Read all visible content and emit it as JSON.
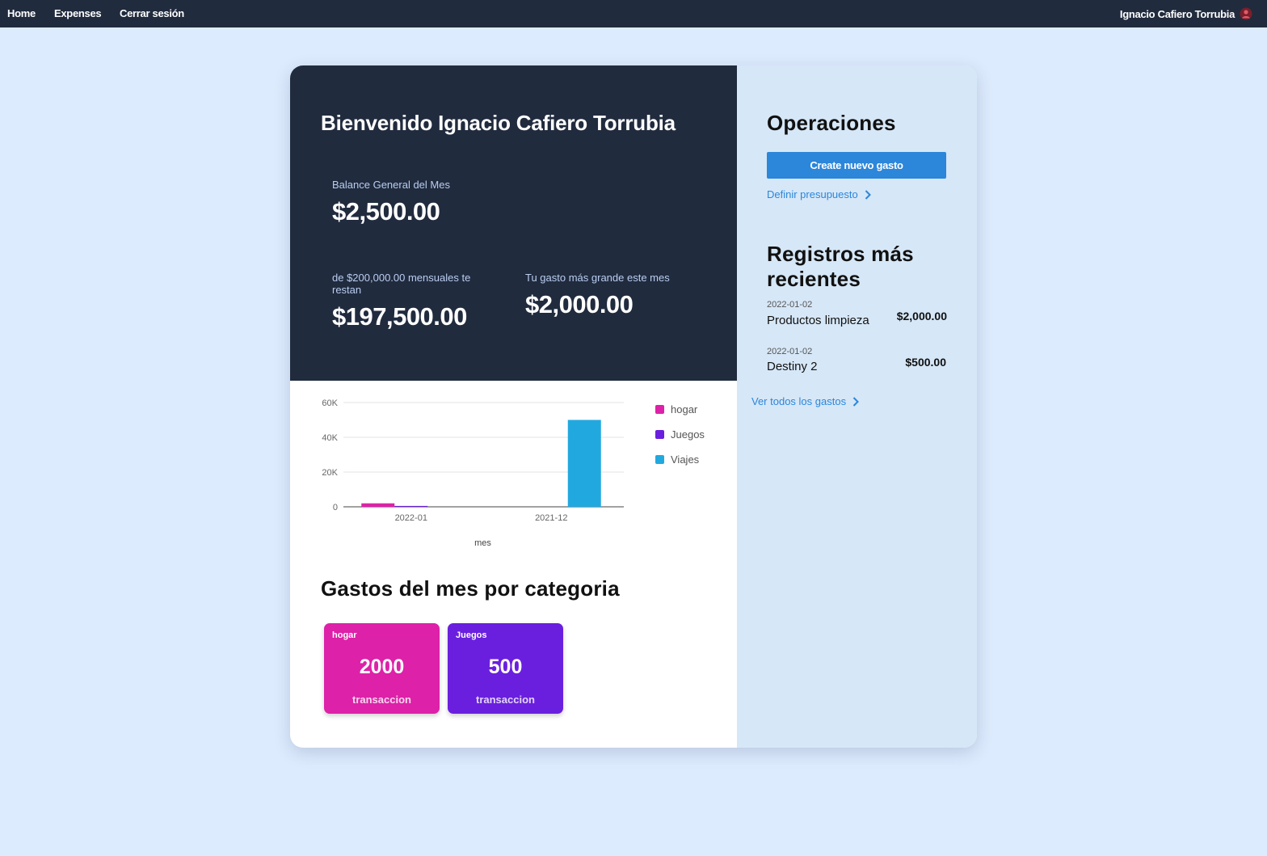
{
  "nav": {
    "links": [
      "Home",
      "Expenses",
      "Cerrar sesión"
    ],
    "user_name": "Ignacio Cafiero Torrubia",
    "avatar_icon": "user-avatar-icon"
  },
  "summary": {
    "welcome": "Bienvenido Ignacio Cafiero Torrubia",
    "balance_label": "Balance General del Mes",
    "balance_value": "$2,500.00",
    "remaining_label": "de $200,000.00 mensuales te restan",
    "remaining_value": "$197,500.00",
    "biggest_label": "Tu gasto más grande este mes",
    "biggest_value": "$2,000.00"
  },
  "operations": {
    "title": "Operaciones",
    "create_button": "Create nuevo gasto",
    "budget_link": "Definir presupuesto"
  },
  "recent": {
    "title": "Registros más recientes",
    "items": [
      {
        "date": "2022-01-02",
        "name": "Productos limpieza",
        "amount": "$2,000.00"
      },
      {
        "date": "2022-01-02",
        "name": "Destiny 2",
        "amount": "$500.00"
      }
    ],
    "view_all_link": "Ver todos los gastos"
  },
  "chart_data": {
    "type": "bar",
    "categories": [
      "2022-01",
      "2021-12"
    ],
    "series": [
      {
        "name": "hogar",
        "color": "#dd21a8",
        "values": [
          2000,
          0
        ]
      },
      {
        "name": "Juegos",
        "color": "#6a1fdf",
        "values": [
          500,
          0
        ]
      },
      {
        "name": "Viajes",
        "color": "#21a9df",
        "values": [
          0,
          50000
        ]
      }
    ],
    "xlabel": "mes",
    "ylabel": "",
    "ylim": [
      0,
      60000
    ],
    "yticks": [
      "0",
      "20K",
      "40K",
      "60K"
    ],
    "grid": true,
    "legend_position": "right"
  },
  "categories_section": {
    "title": "Gastos del mes por categoria",
    "cards": [
      {
        "name": "hogar",
        "value": "2000",
        "unit": "transaccion",
        "color": "#dd21a8"
      },
      {
        "name": "Juegos",
        "value": "500",
        "unit": "transaccion",
        "color": "#6a1fdf"
      }
    ]
  }
}
